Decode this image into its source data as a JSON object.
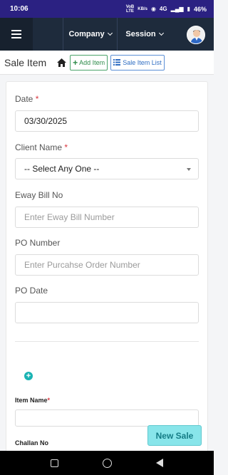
{
  "status_bar": {
    "time": "10:06",
    "network_top": "VoB",
    "network_bottom": "LTE",
    "signal_top": "KB/s",
    "signal_label": "4G",
    "battery": "46%"
  },
  "navbar": {
    "company_label": "Company",
    "session_label": "Session"
  },
  "subbar": {
    "title": "Sale Item",
    "add_label": "Add Item",
    "list_label": "Sale Item List"
  },
  "form": {
    "date_label": "Date",
    "date_value": "03/30/2025",
    "client_label": "Client Name",
    "client_value": "-- Select Any One --",
    "eway_label": "Eway Bill No",
    "eway_placeholder": "Enter Eway Bill Number",
    "po_label": "PO Number",
    "po_placeholder": "Enter Purcahse Order Number",
    "po_date_label": "PO Date",
    "required_mark": "*",
    "item_name_label": "Item Name",
    "challan_label": "Challan No"
  },
  "actions": {
    "new_sale_label": "New Sale"
  },
  "colors": {
    "status_bar": "#2b2182",
    "navbar": "#1e2b3c",
    "required": "#d9363e",
    "new_sale_bg": "#88e5ea",
    "add_icon": "#1ab3b3"
  }
}
